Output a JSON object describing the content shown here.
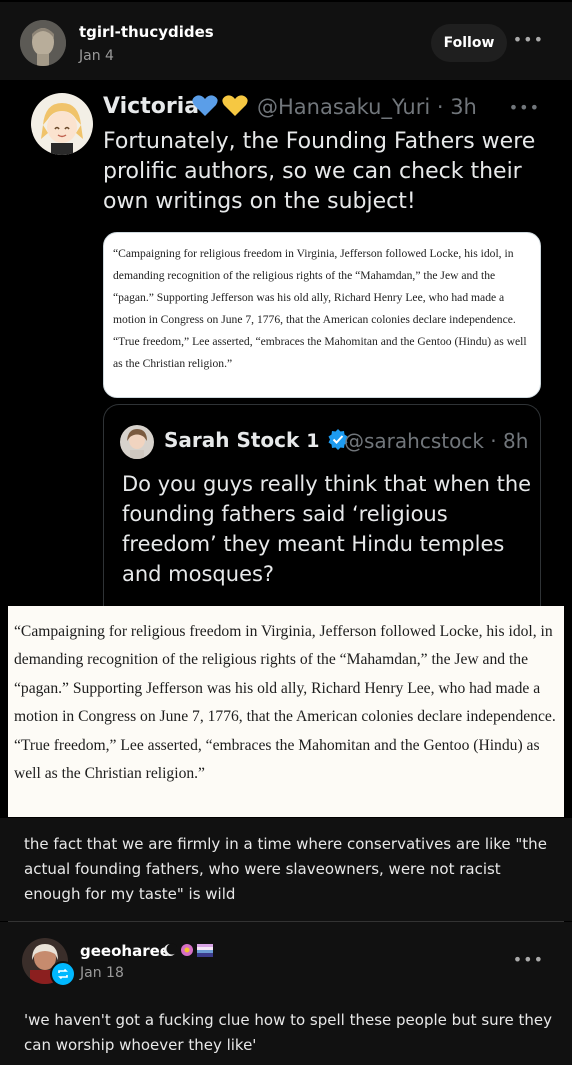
{
  "post": {
    "username": "tgirl-thucydides",
    "date": "Jan 4",
    "follow_label": "Follow",
    "more_label": "•••"
  },
  "tweet": {
    "name": "Victoria",
    "hearts": "💙💛",
    "handle_time": "@Hanasaku_Yuri · 3h",
    "more_label": "•••",
    "text": "Fortunately, the Founding Fathers were prolific authors, so we can check their own writings on the subject!",
    "quote_image_text": "“Campaigning for religious freedom in Virginia, Jefferson followed Locke, his idol, in demanding recognition of the religious rights of the “Mahamdan,” the Jew and the “pagan.” Supporting Jefferson was his old ally, Richard Henry Lee, who had made a motion in Congress on June 7, 1776, that the American colonies declare independence. “True freedom,” Lee asserted, “embraces the Mahomitan and the Gentoo (Hindu) as well as the Christian religion.”"
  },
  "quoted_tweet": {
    "name": "Sarah Stock",
    "name_marker": "1",
    "handle_time": "@sarahcstock · 8h",
    "text": "Do you guys really think that when the founding fathers said ‘religious freedom’ they meant Hindu temples and mosques?"
  },
  "excerpt": {
    "text": "“Campaigning for religious freedom in Virginia, Jefferson followed Locke, his idol, in demanding recognition of the religious rights of the “Mahamdan,” the Jew and the “pagan.” Supporting Jefferson was his old ally, Richard Henry Lee, who had made a motion in Congress on June 7, 1776, that the American colonies declare independence. “True freedom,” Lee asserted, “embraces the Mahomitan and the Gentoo (Hindu) as well as the Christian religion.”"
  },
  "caption": {
    "text": "the fact that we are firmly in a time where conservatives are like \"the actual founding fathers, who were slaveowners, were not racist enough for my taste\" is wild"
  },
  "reply": {
    "username": "geeoharee",
    "date": "Jan 18",
    "more_label": "•••",
    "text": "'we haven't got a fucking clue how to spell these people but sure they can worship whoever they like'"
  },
  "colors": {
    "background": "#000000",
    "post_background": "#111111",
    "verified_blue": "#1d9bf0",
    "reblog_badge": "#00b8ff"
  },
  "icons": [
    "user-avatar",
    "more-dots-icon",
    "verified-badge-icon",
    "reblog-icon",
    "blue-heart",
    "yellow-heart"
  ]
}
